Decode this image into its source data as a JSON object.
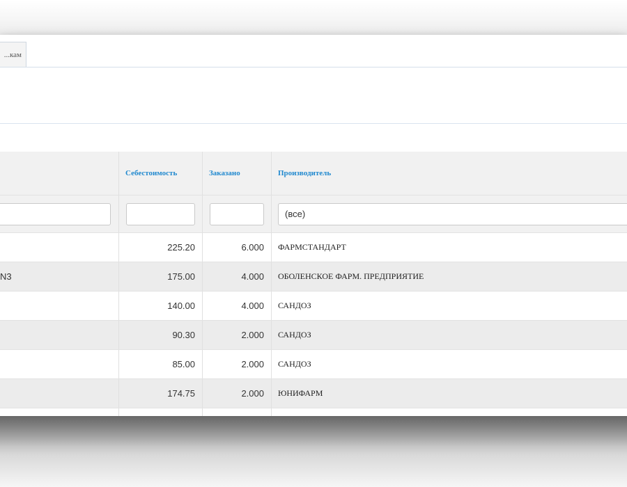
{
  "tabs": [
    {
      "label": "...кам"
    }
  ],
  "columns": [
    {
      "key": "name",
      "label": ""
    },
    {
      "key": "cost",
      "label": "Себестоимость"
    },
    {
      "key": "ordered",
      "label": "Заказано"
    },
    {
      "key": "manufacturer",
      "label": "Производитель"
    }
  ],
  "filters": {
    "name": "",
    "cost": "",
    "ordered": "",
    "manufacturer_selected": "(все)"
  },
  "rows": [
    {
      "name": "",
      "cost": "225.20",
      "ordered": "6.000",
      "manufacturer": "ФАРМСТАНДАРТ"
    },
    {
      "name": "N3",
      "cost": "175.00",
      "ordered": "4.000",
      "manufacturer": "ОБОЛЕНСКОЕ ФАРМ. ПРЕДПРИЯТИЕ"
    },
    {
      "name": "",
      "cost": "140.00",
      "ordered": "4.000",
      "manufacturer": "САНДОЗ"
    },
    {
      "name": "",
      "cost": "90.30",
      "ordered": "2.000",
      "manufacturer": "САНДОЗ"
    },
    {
      "name": "",
      "cost": "85.00",
      "ordered": "2.000",
      "manufacturer": "САНДОЗ"
    },
    {
      "name": "",
      "cost": "174.75",
      "ordered": "2.000",
      "manufacturer": "ЮНИФАРМ"
    }
  ],
  "colors": {
    "header_link": "#2189cf",
    "stripe": "#ececec",
    "header_bg": "#f1f1f1"
  }
}
